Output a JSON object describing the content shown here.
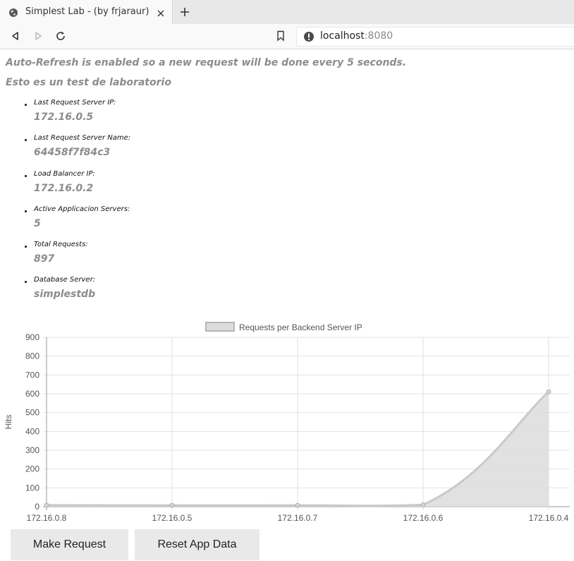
{
  "browser": {
    "tab_title": "Simplest Lab - (by frjaraur)",
    "url_host": "localhost",
    "url_port": ":8080"
  },
  "page": {
    "auto_refresh_notice": "Auto-Refresh is enabled so a new request will be done every 5 seconds.",
    "lab_message": "Esto es un test de laboratorio",
    "info": [
      {
        "label": "Last Request Server IP:",
        "value": "172.16.0.5"
      },
      {
        "label": "Last Request Server Name:",
        "value": "64458f7f84c3"
      },
      {
        "label": "Load Balancer IP:",
        "value": "172.16.0.2"
      },
      {
        "label": "Active Applicacion Servers:",
        "value": "5"
      },
      {
        "label": "Total Requests:",
        "value": "897"
      },
      {
        "label": "Database Server:",
        "value": "simplestdb"
      }
    ]
  },
  "chart_data": {
    "type": "area",
    "title": "",
    "xlabel": "",
    "ylabel": "Hits",
    "categories": [
      "172.16.0.8",
      "172.16.0.5",
      "172.16.0.7",
      "172.16.0.6",
      "172.16.0.4"
    ],
    "series": [
      {
        "name": "Requests per Backend Server IP",
        "values": [
          8,
          7,
          7,
          10,
          610
        ]
      }
    ],
    "ylim": [
      0,
      900
    ],
    "yticks": [
      0,
      100,
      200,
      300,
      400,
      500,
      600,
      700,
      800,
      900
    ],
    "grid": true,
    "legend": "top-center",
    "line_color": "#c9c9c9",
    "fill_color": "#dcdcdc"
  },
  "buttons": {
    "make_request": "Make Request",
    "reset": "Reset App Data"
  }
}
